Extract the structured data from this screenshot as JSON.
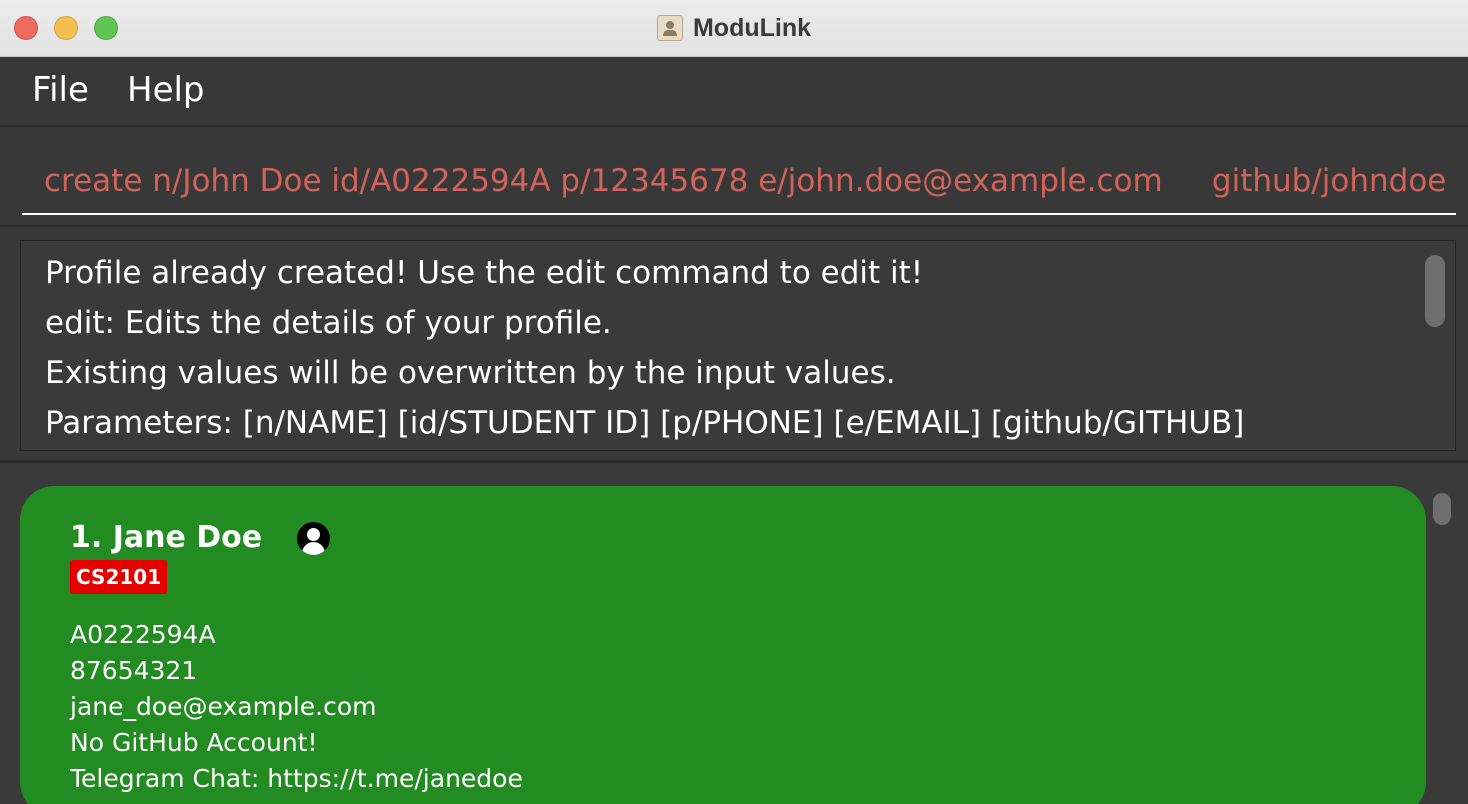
{
  "window": {
    "title": "ModuLink"
  },
  "menu": {
    "file_label": "File",
    "help_label": "Help"
  },
  "command": {
    "value": "create n/John Doe id/A0222594A p/12345678 e/john.doe@example.com     github/johndoe"
  },
  "result": {
    "lines": [
      "Profile already created! Use the edit command to edit it!",
      "edit: Edits the details of your profile.",
      "Existing values will be overwritten by the input values.",
      "Parameters: [n/NAME] [id/STUDENT ID] [p/PHONE] [e/EMAIL] [github/GITHUB]"
    ]
  },
  "persons": [
    {
      "index_name": "1. Jane Doe",
      "tag": "CS2101",
      "student_id": "A0222594A",
      "phone": "87654321",
      "email": "jane_doe@example.com",
      "github": "No GitHub Account!",
      "telegram": "Telegram Chat: https://t.me/janedoe",
      "card_color": "#228b22",
      "tag_color": "#e50000"
    }
  ],
  "colors": {
    "command_text": "#d0635a",
    "background": "#383838"
  }
}
